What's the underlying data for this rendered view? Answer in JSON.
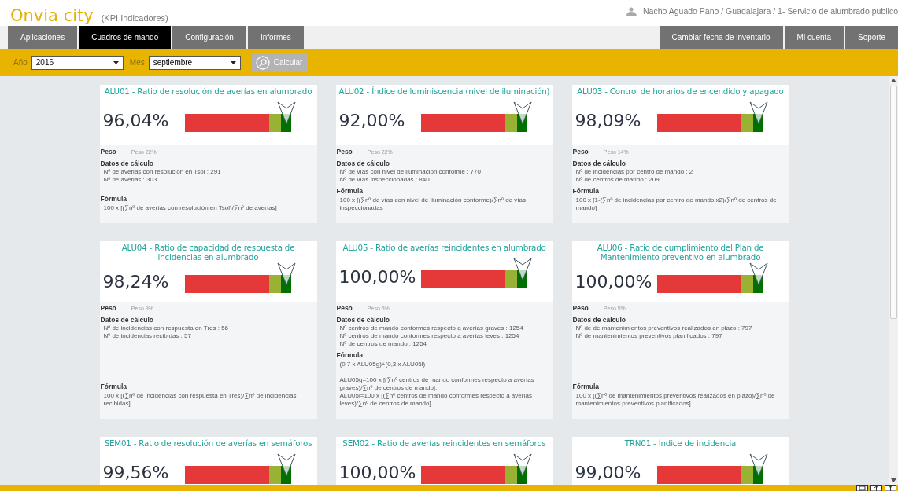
{
  "header": {
    "logo": "Onvia city",
    "subtitle": "(KPI Indicadores)",
    "breadcrumb": "Nacho Aguado Pano / Guadalajara / 1- Servicio de alumbrado publico"
  },
  "nav_left": [
    {
      "label": "Aplicaciones",
      "selected": false
    },
    {
      "label": "Cuadros de mando",
      "selected": true
    },
    {
      "label": "Configuración",
      "selected": false
    },
    {
      "label": "Informes",
      "selected": false
    }
  ],
  "nav_right": [
    {
      "label": "Cambiar fecha de inventario"
    },
    {
      "label": "Mi cuenta"
    },
    {
      "label": "Soporte"
    }
  ],
  "filters": {
    "year_label": "Año",
    "year": "2016",
    "month_label": "Mes",
    "month": "septiembre",
    "button": "Calcular"
  },
  "cards": [
    {
      "title": "ALU01 - Ratio de resolución de averías en alumbrado",
      "value": "96,04%",
      "peso_label": "Peso",
      "peso": "Peso 22%",
      "datos_label": "Datos de cálculo",
      "datos": [
        "Nº de averias con resolución en Tsol : 291",
        "Nº de averias : 303"
      ],
      "formula_label": "Fórmula",
      "formula": [
        [
          "100 x [(∑nº de averías con resolución en Tsol)/∑nº de averías]"
        ]
      ]
    },
    {
      "title": "ALU02 - Índice de luminiscencia (nivel de iluminación)",
      "value": "92,00%",
      "peso_label": "Peso",
      "peso": "Peso 22%",
      "datos_label": "Datos de cálculo",
      "datos": [
        "Nº de vías con nivel de iluminación conforme : 770",
        "Nº de vías inspeccionadas : 840"
      ],
      "formula_label": "Fórmula",
      "formula": [
        [
          "100 x [(∑nº de vías con nivel de iluminación conforme)/∑nº de vías inspeccionadas"
        ]
      ]
    },
    {
      "title": "ALU03 - Control de horarios de encendido y apagado",
      "value": "98,09%",
      "peso_label": "Peso",
      "peso": "Peso 14%",
      "datos_label": "Datos de cálculo",
      "datos": [
        "Nº de incidencias por centro de mando : 2",
        "Nº de centros de mando : 209"
      ],
      "formula_label": "Fórmula",
      "formula": [
        [
          "100 x [1-(∑nº de incidencias por centro de mando x2)/∑nº de centros de mando]"
        ]
      ]
    },
    {
      "title": "ALU04 - Ratio de capacidad de respuesta de incidencias en alumbrado",
      "value": "98,24%",
      "peso_label": "Peso",
      "peso": "Peso 9%",
      "datos_label": "Datos de cálculo",
      "datos": [
        "Nº de incidencias con respuesta en Tres : 56",
        "Nº de incidencias recibidas : 57"
      ],
      "formula_label": "Fórmula",
      "formula": [
        [
          "100 x [(∑nº de incidencias con respuesta en Tres)/∑nº de incidencias recibidas]"
        ]
      ]
    },
    {
      "title": "ALU05 - Ratio de averías reincidentes en alumbrado",
      "value": "100,00%",
      "peso_label": "Peso",
      "peso": "Peso 5%",
      "datos_label": "Datos de cálculo",
      "datos": [
        "Nº centros de mando conformes respecto a averías graves : 1254",
        "Nº centros de mando conformes respecto a averías leves : 1254",
        "Nº de centros de mando : 1254"
      ],
      "formula_label": "Fórmula",
      "formula": [
        [
          "(0,7 x ALU05g)+(0,3 x ALU05l)"
        ],
        [
          "ALU05g=100 x [(∑nº centros de mando conformes respecto a averías graves)/∑nº de centros de mando].",
          "ALU05l=100 x [(∑nº centros de mando conformes respecto a averías leves)/∑nº de centros de mando]"
        ]
      ]
    },
    {
      "title": "ALU06 - Ratio de cumplimiento del Plan de Mantenimiento preventivo en alumbrado",
      "value": "100,00%",
      "peso_label": "Peso",
      "peso": "Peso 5%",
      "datos_label": "Datos de cálculo",
      "datos": [
        "Nº de de mantenimientos preventivos realizados en plazo : 797",
        "Nº de mantenimientos preventivos planificados : 797"
      ],
      "formula_label": "Fórmula",
      "formula": [
        [
          "100 x [(∑nº de mantenimientos preventivos realizados en plazo)/∑nº de mantenimientos preventivos planificados]"
        ]
      ]
    },
    {
      "title": "SEM01 - Ratio de resolución de averías en semáforos",
      "value": "99,56%"
    },
    {
      "title": "SEM02 - Ratio de averías reincidentes en semáforos",
      "value": "100,00%"
    },
    {
      "title": "TRN01 - Índice de incidencia",
      "value": "99,00%"
    }
  ]
}
